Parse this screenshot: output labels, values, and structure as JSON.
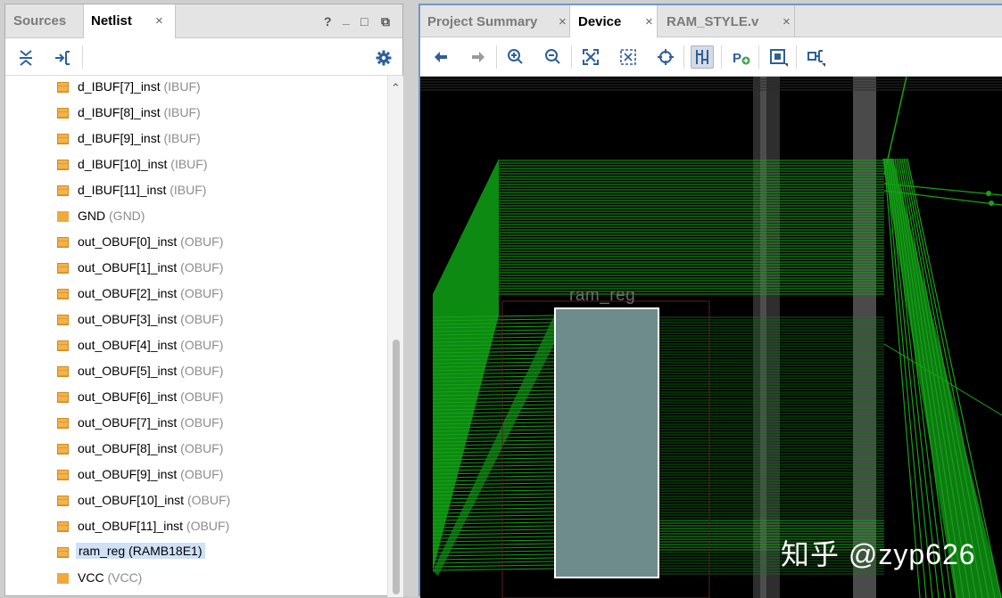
{
  "left_panel": {
    "tabs": [
      {
        "label": "Sources",
        "active": false
      },
      {
        "label": "Netlist",
        "active": true
      }
    ],
    "window_controls": {
      "help": "?",
      "minimize": "_",
      "maximize": "□",
      "float": "⧉"
    },
    "toolbar_icons": [
      "collapse-all-icon",
      "expand-selection-icon",
      "settings-gear-icon"
    ],
    "tree_items": [
      {
        "name": "d_IBUF[7]_inst",
        "type": "(IBUF)",
        "icon": "striped-cell-icon"
      },
      {
        "name": "d_IBUF[8]_inst",
        "type": "(IBUF)",
        "icon": "striped-cell-icon"
      },
      {
        "name": "d_IBUF[9]_inst",
        "type": "(IBUF)",
        "icon": "striped-cell-icon"
      },
      {
        "name": "d_IBUF[10]_inst",
        "type": "(IBUF)",
        "icon": "striped-cell-icon"
      },
      {
        "name": "d_IBUF[11]_inst",
        "type": "(IBUF)",
        "icon": "striped-cell-icon"
      },
      {
        "name": "GND",
        "type": "(GND)",
        "icon": "solid-cell-icon"
      },
      {
        "name": "out_OBUF[0]_inst",
        "type": "(OBUF)",
        "icon": "striped-cell-icon"
      },
      {
        "name": "out_OBUF[1]_inst",
        "type": "(OBUF)",
        "icon": "striped-cell-icon"
      },
      {
        "name": "out_OBUF[2]_inst",
        "type": "(OBUF)",
        "icon": "striped-cell-icon"
      },
      {
        "name": "out_OBUF[3]_inst",
        "type": "(OBUF)",
        "icon": "striped-cell-icon"
      },
      {
        "name": "out_OBUF[4]_inst",
        "type": "(OBUF)",
        "icon": "striped-cell-icon"
      },
      {
        "name": "out_OBUF[5]_inst",
        "type": "(OBUF)",
        "icon": "striped-cell-icon"
      },
      {
        "name": "out_OBUF[6]_inst",
        "type": "(OBUF)",
        "icon": "striped-cell-icon"
      },
      {
        "name": "out_OBUF[7]_inst",
        "type": "(OBUF)",
        "icon": "striped-cell-icon"
      },
      {
        "name": "out_OBUF[8]_inst",
        "type": "(OBUF)",
        "icon": "striped-cell-icon"
      },
      {
        "name": "out_OBUF[9]_inst",
        "type": "(OBUF)",
        "icon": "striped-cell-icon"
      },
      {
        "name": "out_OBUF[10]_inst",
        "type": "(OBUF)",
        "icon": "striped-cell-icon"
      },
      {
        "name": "out_OBUF[11]_inst",
        "type": "(OBUF)",
        "icon": "striped-cell-icon"
      },
      {
        "name": "ram_reg",
        "type": "(RAMB18E1)",
        "icon": "striped-cell-icon",
        "selected": true
      },
      {
        "name": "VCC",
        "type": "(VCC)",
        "icon": "solid-cell-icon"
      }
    ]
  },
  "right_panel": {
    "tabs": [
      {
        "label": "Project Summary",
        "active": false
      },
      {
        "label": "Device",
        "active": true
      },
      {
        "label": "RAM_STYLE.v",
        "active": false
      }
    ],
    "toolbar_icons": [
      "back-arrow-icon",
      "forward-arrow-icon",
      "zoom-in-icon",
      "zoom-out-icon",
      "zoom-fit-icon",
      "zoom-selection-icon",
      "crosshair-icon",
      "routing-resources-icon",
      "create-pblock-icon",
      "fit-box-icon",
      "ports-icon"
    ],
    "device_view": {
      "cell_label": "ram_reg",
      "watermark": "知乎 @zyp626",
      "colors": {
        "background": "#000000",
        "routing": "#17a317",
        "cell_fill": "#6f8c8c",
        "column": "#4a4a4a"
      }
    }
  },
  "colors": {
    "accent_border": "#6e98c9",
    "selection": "#cfe0f7",
    "cell_icon": "#f0a93d"
  }
}
